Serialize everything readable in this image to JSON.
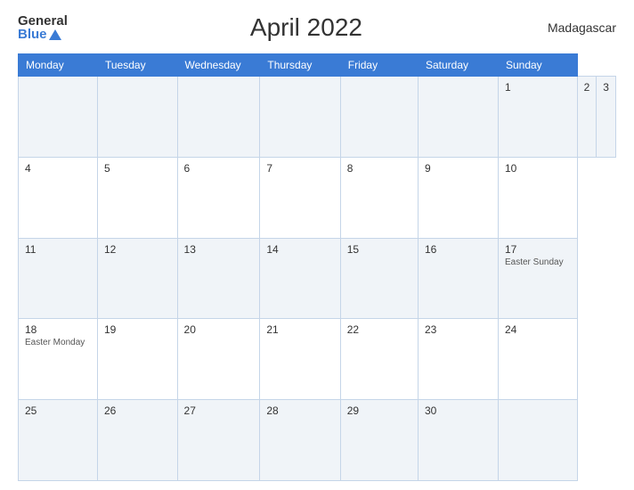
{
  "header": {
    "logo_general": "General",
    "logo_blue": "Blue",
    "title": "April 2022",
    "country": "Madagascar"
  },
  "calendar": {
    "weekdays": [
      "Monday",
      "Tuesday",
      "Wednesday",
      "Thursday",
      "Friday",
      "Saturday",
      "Sunday"
    ],
    "weeks": [
      [
        {
          "day": "",
          "holiday": ""
        },
        {
          "day": "",
          "holiday": ""
        },
        {
          "day": "",
          "holiday": ""
        },
        {
          "day": "1",
          "holiday": ""
        },
        {
          "day": "2",
          "holiday": ""
        },
        {
          "day": "3",
          "holiday": ""
        }
      ],
      [
        {
          "day": "4",
          "holiday": ""
        },
        {
          "day": "5",
          "holiday": ""
        },
        {
          "day": "6",
          "holiday": ""
        },
        {
          "day": "7",
          "holiday": ""
        },
        {
          "day": "8",
          "holiday": ""
        },
        {
          "day": "9",
          "holiday": ""
        },
        {
          "day": "10",
          "holiday": ""
        }
      ],
      [
        {
          "day": "11",
          "holiday": ""
        },
        {
          "day": "12",
          "holiday": ""
        },
        {
          "day": "13",
          "holiday": ""
        },
        {
          "day": "14",
          "holiday": ""
        },
        {
          "day": "15",
          "holiday": ""
        },
        {
          "day": "16",
          "holiday": ""
        },
        {
          "day": "17",
          "holiday": "Easter Sunday"
        }
      ],
      [
        {
          "day": "18",
          "holiday": "Easter Monday"
        },
        {
          "day": "19",
          "holiday": ""
        },
        {
          "day": "20",
          "holiday": ""
        },
        {
          "day": "21",
          "holiday": ""
        },
        {
          "day": "22",
          "holiday": ""
        },
        {
          "day": "23",
          "holiday": ""
        },
        {
          "day": "24",
          "holiday": ""
        }
      ],
      [
        {
          "day": "25",
          "holiday": ""
        },
        {
          "day": "26",
          "holiday": ""
        },
        {
          "day": "27",
          "holiday": ""
        },
        {
          "day": "28",
          "holiday": ""
        },
        {
          "day": "29",
          "holiday": ""
        },
        {
          "day": "30",
          "holiday": ""
        },
        {
          "day": "",
          "holiday": ""
        }
      ]
    ]
  }
}
